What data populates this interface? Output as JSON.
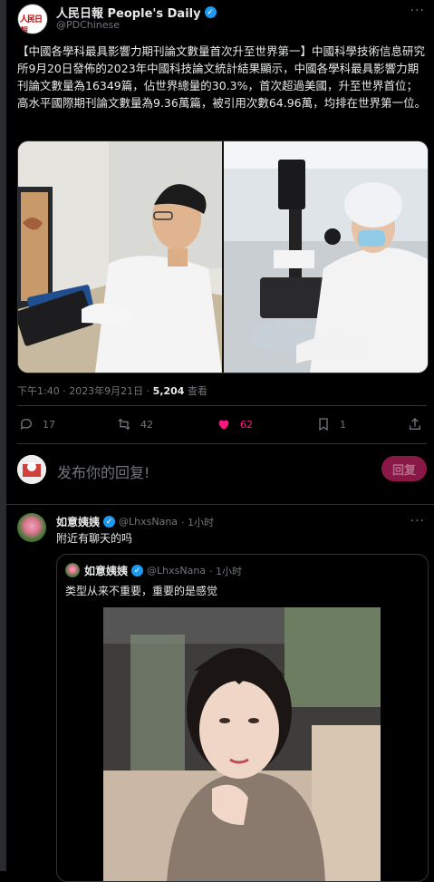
{
  "tweet": {
    "display_name": "人民日報 People's Daily",
    "handle": "@PDChinese",
    "avatar_text": "人民日報",
    "text": "【中國各學科最具影響力期刊論文數量首次升至世界第一】中國科學技術信息研究所9月20日發佈的2023年中國科技論文統計結果顯示，中國各學科最具影響力期刊論文數量為16349篇，佔世界總量的30.3%，首次超過美國，升至世界首位；高水平國際期刊論文數量為9.36萬篇，被引用次數64.96萬，均排在世界第一位。",
    "time": "下午1:40 · 2023年9月21日 · ",
    "views": "5,204",
    "views_label": " 查看",
    "replies": "17",
    "retweets": "42",
    "likes": "62",
    "bookmarks": "1",
    "like_color": "#f91880"
  },
  "reply_box": {
    "placeholder": "发布你的回复!",
    "button": "回复"
  },
  "reply": {
    "display_name": "如意姨姨",
    "handle": "@LhxsNana",
    "time": "· 1小时",
    "text": "附近有聊天的吗",
    "quote": {
      "display_name": "如意姨姨",
      "handle": "@LhxsNana",
      "time": "· 1小时",
      "text": "类型从来不重要，重要的是感觉"
    }
  }
}
